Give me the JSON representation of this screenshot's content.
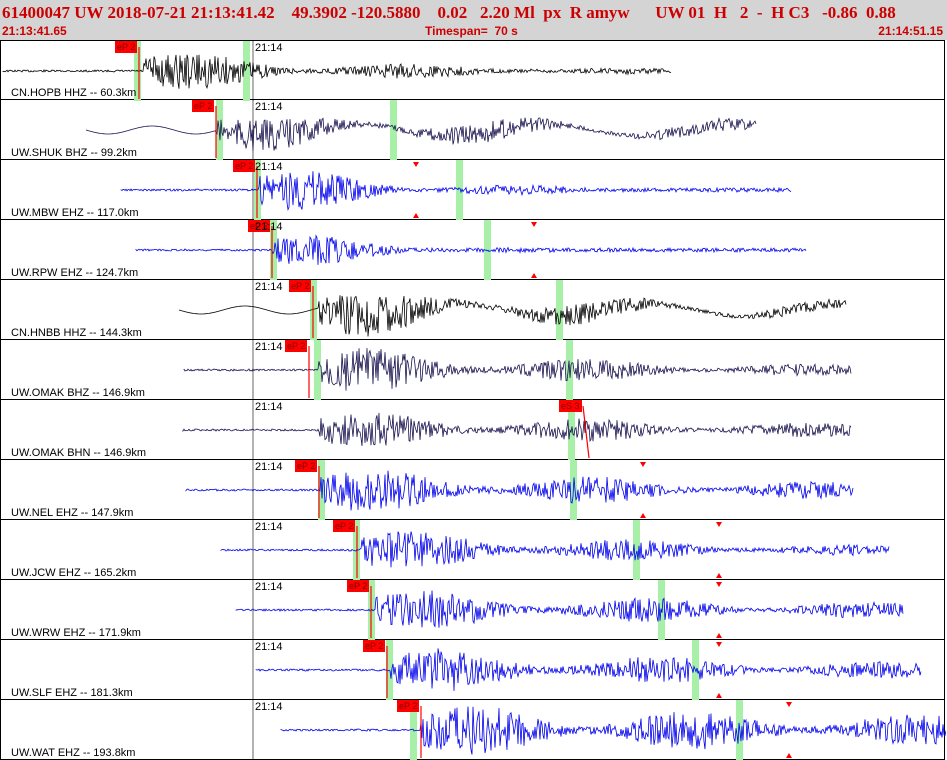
{
  "header": {
    "title": "61400047 UW 2018-07-21 21:13:41.42    49.3902 -120.5880    0.02   2.20 Ml  px  R amyw      UW 01  H   2  -  H C3   -0.86  0.88",
    "start_time": "21:13:41.65",
    "timespan": "Timespan=  70 s",
    "end_time": "21:14:51.15"
  },
  "time_tick_label": "21:14",
  "pick_label": "eP 2",
  "s_pick_label": "eS 3",
  "colors": {
    "black_trace": "#000000",
    "navy_trace": "#1a1450",
    "blue_trace": "#0000ee",
    "pick": "#ff0000",
    "green_marker": "#a8f0a8"
  },
  "channels": [
    {
      "label": "CN.HOPB HHZ -- 60.3km",
      "color": "black"
    },
    {
      "label": "UW.SHUK BHZ -- 99.2km",
      "color": "navy"
    },
    {
      "label": "UW.MBW EHZ -- 117.0km",
      "color": "blue"
    },
    {
      "label": "UW.RPW EHZ -- 124.7km",
      "color": "blue"
    },
    {
      "label": "CN.HNBB HHZ -- 144.3km",
      "color": "black"
    },
    {
      "label": "UW.OMAK BHZ -- 146.9km",
      "color": "navy"
    },
    {
      "label": "UW.OMAK BHN -- 146.9km",
      "color": "navy"
    },
    {
      "label": "UW.NEL EHZ -- 147.9km",
      "color": "blue"
    },
    {
      "label": "UW.JCW EHZ -- 165.2km",
      "color": "blue"
    },
    {
      "label": "UW.WRW EHZ -- 171.9km",
      "color": "blue"
    },
    {
      "label": "UW.SLF EHZ -- 181.3km",
      "color": "blue"
    },
    {
      "label": "UW.WAT EHZ -- 193.8km",
      "color": "blue"
    }
  ]
}
